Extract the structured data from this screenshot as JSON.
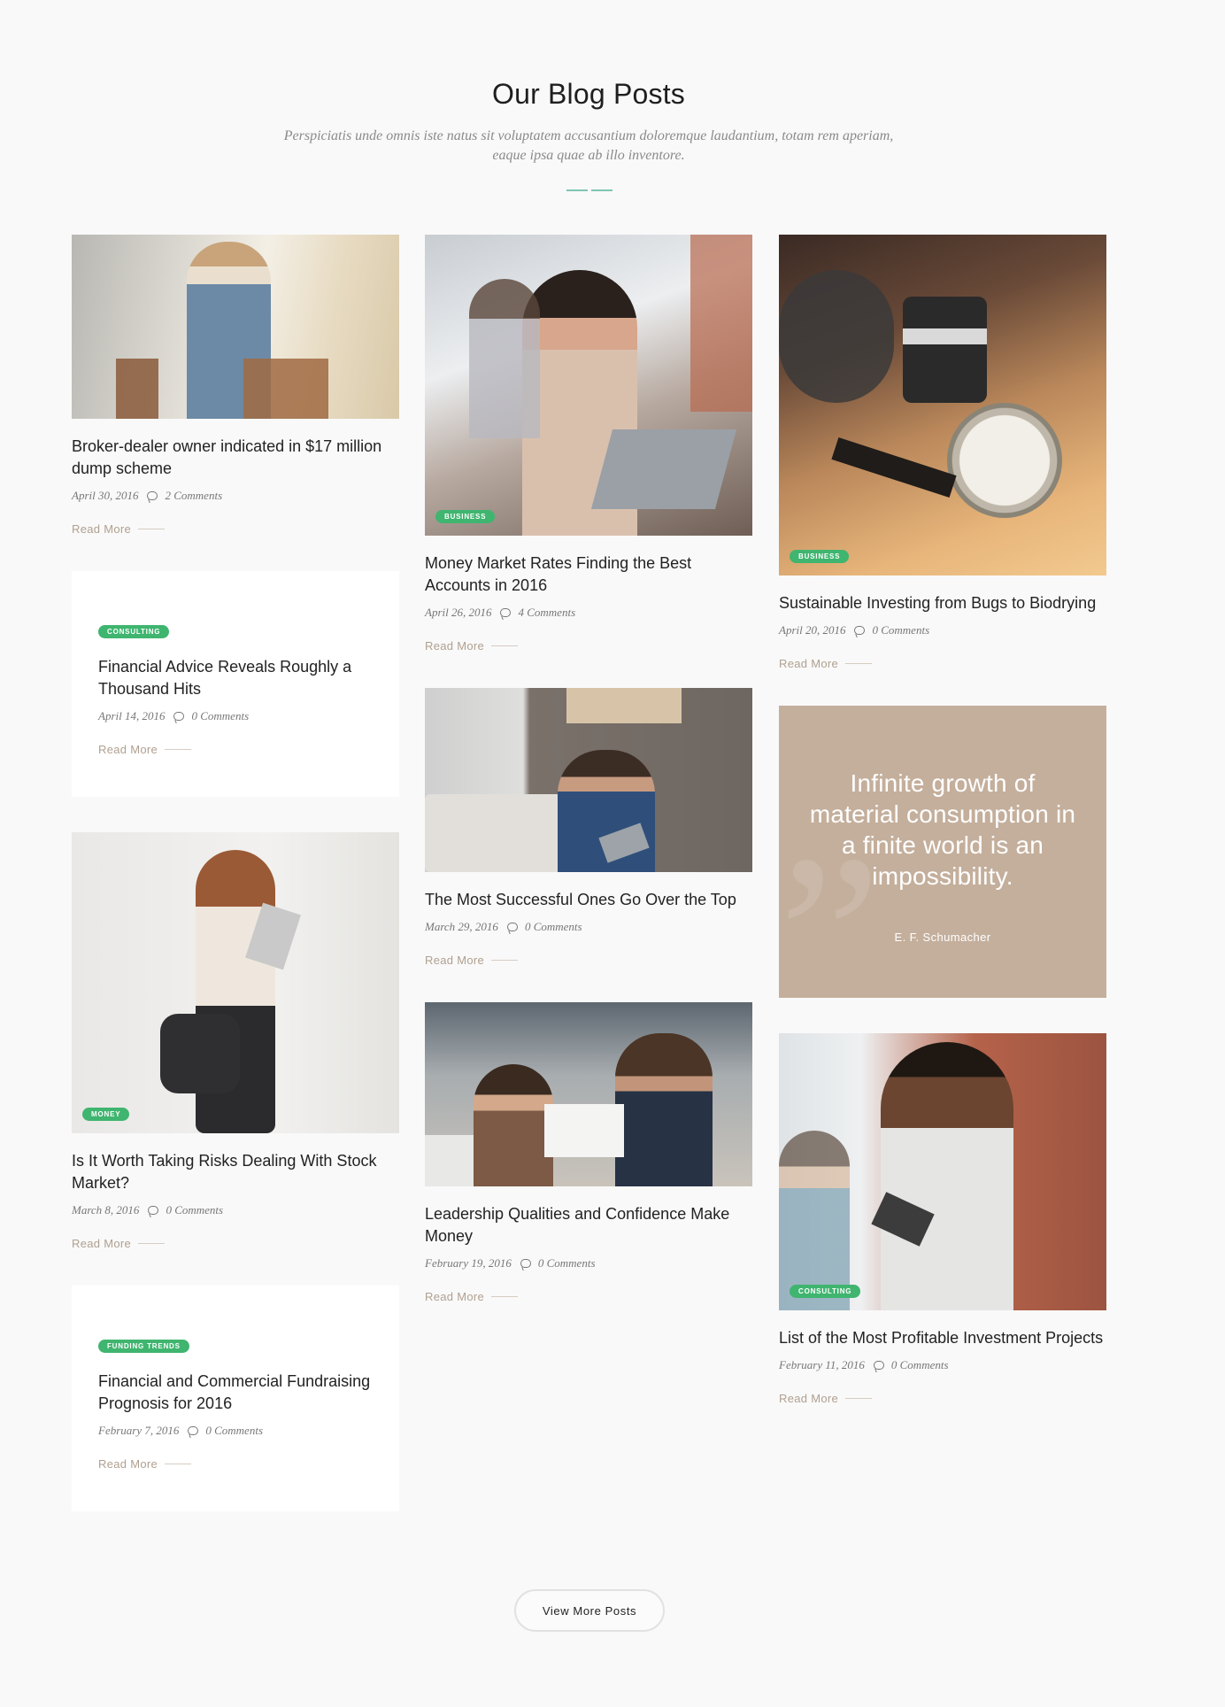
{
  "header": {
    "title": "Our Blog Posts",
    "subtitle": "Perspiciatis unde omnis iste natus sit voluptatem accusantium doloremque laudantium, totam rem aperiam, eaque ipsa quae ab illo inventore."
  },
  "colors": {
    "accent": "#3fb56f",
    "divider": "#7fc4b2",
    "quote_bg": "#c4af9c",
    "read_more": "#b0a090"
  },
  "columns": [
    [
      {
        "type": "image",
        "title": "Broker-dealer owner indicated in $17 million dump scheme",
        "date": "April 30, 2016",
        "comments": "2 Comments",
        "read_more": "Read More",
        "badge": ""
      },
      {
        "type": "text",
        "title": "Financial Advice Reveals Roughly a Thousand Hits",
        "date": "April 14, 2016",
        "comments": "0 Comments",
        "read_more": "Read More",
        "badge": "Consulting"
      },
      {
        "type": "image",
        "title": "Is It Worth Taking Risks Dealing With Stock Market?",
        "date": "March 8, 2016",
        "comments": "0 Comments",
        "read_more": "Read More",
        "badge": "Money"
      },
      {
        "type": "text",
        "title": "Financial and Commercial Fundraising Prognosis for 2016",
        "date": "February 7, 2016",
        "comments": "0 Comments",
        "read_more": "Read More",
        "badge": "Funding Trends"
      }
    ],
    [
      {
        "type": "image",
        "title": "Money Market Rates Finding the Best Accounts in 2016",
        "date": "April 26, 2016",
        "comments": "4 Comments",
        "read_more": "Read More",
        "badge": "Business"
      },
      {
        "type": "image",
        "title": "The Most Successful Ones Go Over the Top",
        "date": "March 29, 2016",
        "comments": "0 Comments",
        "read_more": "Read More",
        "badge": ""
      },
      {
        "type": "image",
        "title": "Leadership Qualities and Confidence Make Money",
        "date": "February 19, 2016",
        "comments": "0 Comments",
        "read_more": "Read More",
        "badge": ""
      }
    ],
    [
      {
        "type": "image",
        "title": "Sustainable Investing from Bugs to Biodrying",
        "date": "April 20, 2016",
        "comments": "0 Comments",
        "read_more": "Read More",
        "badge": "Business"
      },
      {
        "type": "quote",
        "quote": "Infinite growth of material consumption in a finite world is an impossibility.",
        "author": "E. F. Schumacher"
      },
      {
        "type": "image",
        "title": "List of the Most Profitable Investment Projects",
        "date": "February 11, 2016",
        "comments": "0 Comments",
        "read_more": "Read More",
        "badge": "Consulting"
      }
    ]
  ],
  "footer": {
    "more_button": "View More Posts"
  }
}
